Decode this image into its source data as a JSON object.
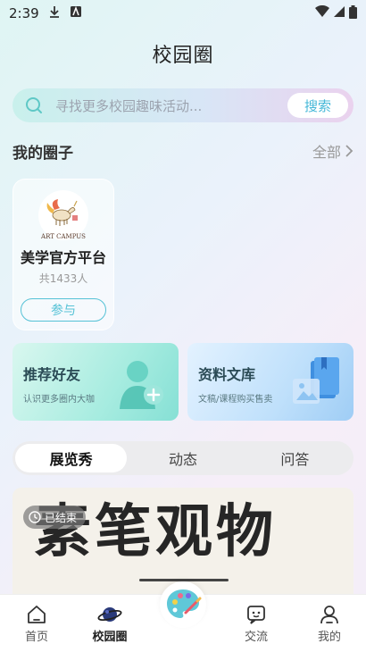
{
  "status_bar": {
    "time": "2:39"
  },
  "header": {
    "title": "校园圈"
  },
  "search": {
    "placeholder": "寻找更多校园趣味活动...",
    "button_label": "搜索"
  },
  "my_circles": {
    "title": "我的圈子",
    "more_label": "全部",
    "items": [
      {
        "name": "美学官方平台",
        "member_count": "共1433人",
        "join_label": "参与",
        "logo_text": "ART CAMPUS"
      }
    ]
  },
  "features": [
    {
      "title": "推荐好友",
      "subtitle": "认识更多圈内大咖"
    },
    {
      "title": "资料文库",
      "subtitle": "文稿/课程购买售卖"
    }
  ],
  "tabs": [
    {
      "label": "展览秀",
      "active": true
    },
    {
      "label": "动态",
      "active": false
    },
    {
      "label": "问答",
      "active": false
    }
  ],
  "banner": {
    "title": "素笔观物",
    "badge": "已结束"
  },
  "bottom_nav": [
    {
      "label": "首页",
      "icon": "home-icon"
    },
    {
      "label": "校园圈",
      "icon": "planet-icon",
      "active": true
    },
    {
      "label": "",
      "icon": "palette-icon"
    },
    {
      "label": "交流",
      "icon": "chat-icon"
    },
    {
      "label": "我的",
      "icon": "profile-icon"
    }
  ],
  "colors": {
    "accent": "#56c2d6",
    "search_button_text": "#46b8d8"
  }
}
